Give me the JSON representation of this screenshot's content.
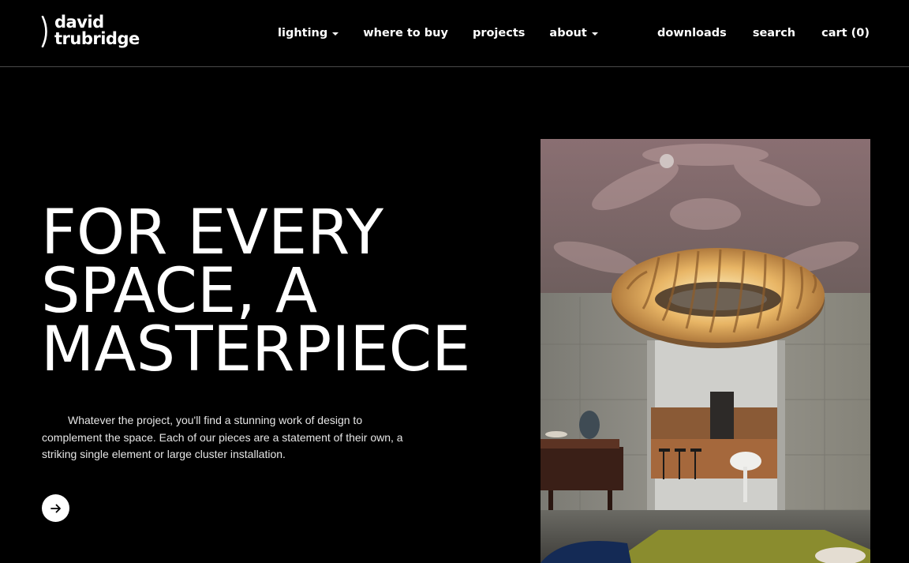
{
  "brand": {
    "line1": "david",
    "line2": "trubridge"
  },
  "nav": {
    "main": [
      {
        "label": "lighting",
        "dropdown": true
      },
      {
        "label": "where to buy",
        "dropdown": false
      },
      {
        "label": "projects",
        "dropdown": false
      },
      {
        "label": "about",
        "dropdown": true
      }
    ],
    "right": [
      {
        "label": "downloads"
      },
      {
        "label": "search"
      },
      {
        "label": "cart (0)"
      }
    ]
  },
  "hero": {
    "title_lines": [
      "FOR EVERY",
      "SPACE, A",
      "MASTERPIECE"
    ],
    "body": "Whatever the project, you'll find a stunning work of design to complement the space. Each of our pieces are a statement of their own, a striking single element or large cluster installation.",
    "cta_icon": "arrow-right-icon"
  },
  "colors": {
    "background": "#000000",
    "text": "#ffffff",
    "divider": "#4a4a4a"
  }
}
